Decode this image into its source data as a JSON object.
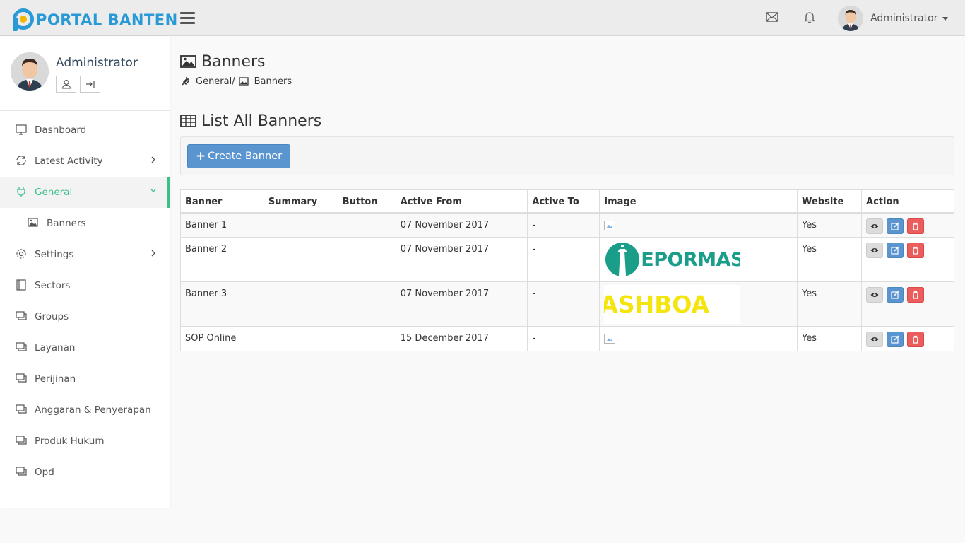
{
  "brand": {
    "name": "PORTAL BANTEN"
  },
  "topbar": {
    "user_name": "Administrator",
    "icons": [
      "hamburger-icon",
      "mail-icon",
      "bell-icon",
      "caret-down-icon"
    ]
  },
  "sidebar": {
    "profile_name": "Administrator",
    "items": [
      {
        "label": "Dashboard",
        "icon": "monitor-icon"
      },
      {
        "label": "Latest Activity",
        "icon": "refresh-icon"
      },
      {
        "label": "General",
        "icon": "plug-icon"
      },
      {
        "label": "Banners",
        "icon": "image-icon"
      },
      {
        "label": "Settings",
        "icon": "gear-icon"
      },
      {
        "label": "Sectors",
        "icon": "book-icon"
      },
      {
        "label": "Groups",
        "icon": "windows-icon"
      },
      {
        "label": "Layanan",
        "icon": "windows-icon"
      },
      {
        "label": "Perijinan",
        "icon": "windows-icon"
      },
      {
        "label": "Anggaran & Penyerapan",
        "icon": "windows-icon"
      },
      {
        "label": "Produk Hukum",
        "icon": "windows-icon"
      },
      {
        "label": "Opd",
        "icon": "windows-icon"
      }
    ]
  },
  "page": {
    "title": "Banners",
    "breadcrumb": {
      "parent": "General/",
      "current": "Banners"
    },
    "panel_title": "List All Banners",
    "create_button": "Create Banner"
  },
  "table": {
    "headers": [
      "Banner",
      "Summary",
      "Button",
      "Active From",
      "Active To",
      "Image",
      "Website",
      "Action"
    ],
    "rows": [
      {
        "banner": "Banner 1",
        "summary": "",
        "button": "",
        "active_from": "07 November 2017",
        "active_to": "-",
        "image": "broken",
        "website": "Yes"
      },
      {
        "banner": "Banner 2",
        "summary": "",
        "button": "",
        "active_from": "07 November 2017",
        "active_to": "-",
        "image": "EPORMAS",
        "website": "Yes"
      },
      {
        "banner": "Banner 3",
        "summary": "",
        "button": "",
        "active_from": "07 November 2017",
        "active_to": "-",
        "image": "ASHBOA",
        "website": "Yes"
      },
      {
        "banner": "SOP Online",
        "summary": "",
        "button": "",
        "active_from": "15 December 2017",
        "active_to": "-",
        "image": "broken",
        "website": "Yes"
      }
    ]
  },
  "colors": {
    "brand": "#2a9ad6",
    "accent": "#3cc08a",
    "primary": "#5b95d0",
    "danger": "#ec5d5d",
    "eparmas_teal": "#1a9e8a",
    "dashboard_yellow": "#f5e50f"
  }
}
